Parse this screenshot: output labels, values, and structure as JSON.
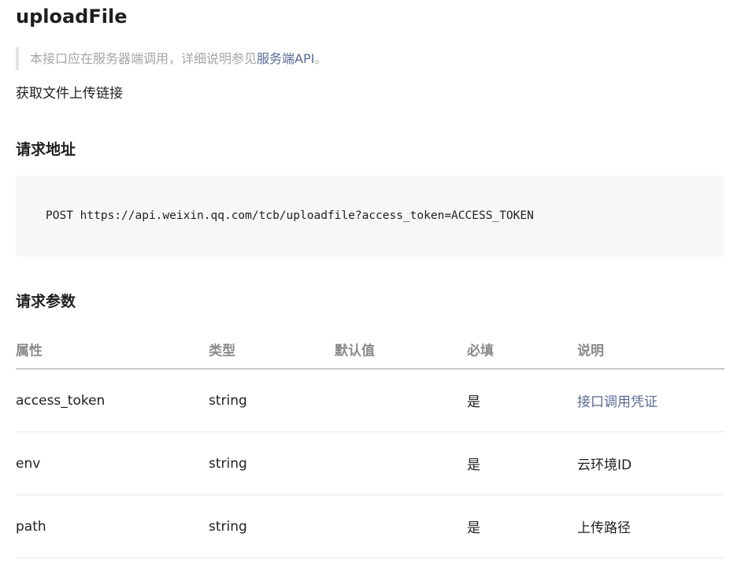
{
  "doc": {
    "title": "uploadFile",
    "notice": {
      "prefix": "本接口应在服务器端调用，详细说明参见",
      "link_text": "服务端API",
      "suffix": "。"
    },
    "description": "获取文件上传链接",
    "request_url_section": {
      "heading": "请求地址",
      "code": "POST https://api.weixin.qq.com/tcb/uploadfile?access_token=ACCESS_TOKEN"
    },
    "request_params_section": {
      "heading": "请求参数",
      "columns": {
        "name": "属性",
        "type": "类型",
        "default": "默认值",
        "required": "必填",
        "desc": "说明"
      },
      "rows": [
        {
          "name": "access_token",
          "type": "string",
          "default": "",
          "required": "是",
          "desc": "接口调用凭证",
          "desc_is_link": true
        },
        {
          "name": "env",
          "type": "string",
          "default": "",
          "required": "是",
          "desc": "云环境ID",
          "desc_is_link": false
        },
        {
          "name": "path",
          "type": "string",
          "default": "",
          "required": "是",
          "desc": "上传路径",
          "desc_is_link": false
        }
      ]
    },
    "colors": {
      "link": "#576b95",
      "muted": "#a6a6a6",
      "code_bg": "#f7f7f7"
    }
  }
}
